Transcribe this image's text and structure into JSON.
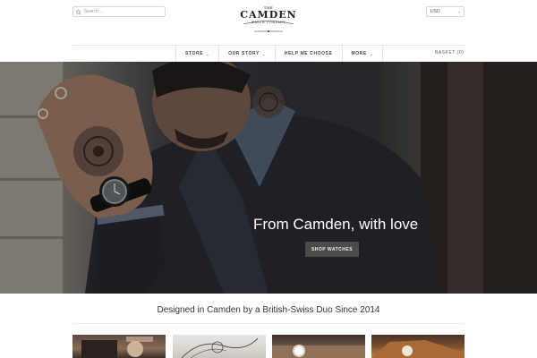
{
  "header": {
    "search": {
      "placeholder": "Search ...",
      "value": ""
    },
    "logo": {
      "line_top": "THE",
      "name": "CAMDEN",
      "line_bottom": "WATCH COMPANY"
    },
    "currency": {
      "selected": "USD"
    }
  },
  "nav": {
    "items": [
      {
        "label": "STORE",
        "has_dropdown": true
      },
      {
        "label": "OUR STORY",
        "has_dropdown": true
      },
      {
        "label": "HELP ME CHOOSE",
        "has_dropdown": false
      },
      {
        "label": "MORE",
        "has_dropdown": true
      }
    ],
    "basket": {
      "label": "BASKET",
      "count": "(0)"
    }
  },
  "hero": {
    "title": "From Camden, with love",
    "button_label": "SHOP WATCHES"
  },
  "tagline": "Designed in Camden by a British-Swiss Duo Since 2014",
  "icons": {
    "search": "search-icon",
    "dropdown": "chevron-down-icon"
  },
  "colors": {
    "hero_button": "#4b4b4b",
    "text": "#333333",
    "divider": "#e5e5e5"
  }
}
